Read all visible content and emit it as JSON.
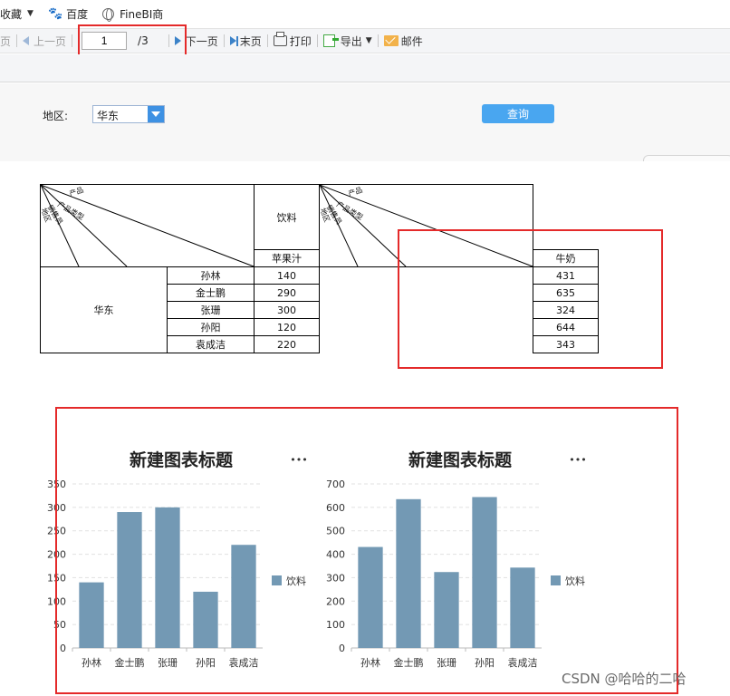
{
  "bookmarks": [
    {
      "label": "收藏",
      "icon": "caret-icon"
    },
    {
      "label": "百度",
      "icon": "baidu-paw-icon"
    },
    {
      "label": "FineBI商",
      "icon": "globe-icon"
    }
  ],
  "toolbar": {
    "first_page": "页",
    "prev_page": "上一页",
    "page_value": "1",
    "page_total": "/3",
    "next_page": "下一页",
    "last_page": "末页",
    "print": "打印",
    "export": "导出",
    "mail": "邮件"
  },
  "param": {
    "region_label": "地区:",
    "region_value": "华东",
    "query_label": "查询"
  },
  "report": {
    "diag_labels": [
      "产品",
      "产品类型",
      "销售员",
      "地区"
    ],
    "left_header": "饮料",
    "left_product": "苹果汁",
    "right_product": "牛奶",
    "region": "华东",
    "rows": [
      {
        "name": "孙林",
        "left": "140",
        "right": "431"
      },
      {
        "name": "金士鹏",
        "left": "290",
        "right": "635"
      },
      {
        "name": "张珊",
        "left": "300",
        "right": "324"
      },
      {
        "name": "孙阳",
        "left": "120",
        "right": "644"
      },
      {
        "name": "袁成洁",
        "left": "220",
        "right": "343"
      }
    ]
  },
  "colors": {
    "bar": "#7399b4",
    "highlight": "#e42a2a",
    "query_button": "#49a6f0"
  },
  "chart_data": [
    {
      "type": "bar",
      "title": "新建图表标题",
      "categories": [
        "孙林",
        "金士鹏",
        "张珊",
        "孙阳",
        "袁成洁"
      ],
      "series": [
        {
          "name": "饮料",
          "values": [
            140,
            290,
            300,
            120,
            220
          ]
        }
      ],
      "ylim": [
        0,
        350
      ],
      "yticks": [
        0,
        50,
        100,
        150,
        200,
        250,
        300,
        350
      ],
      "grid": true,
      "legend": "right",
      "menu_label": "•••"
    },
    {
      "type": "bar",
      "title": "新建图表标题",
      "categories": [
        "孙林",
        "金士鹏",
        "张珊",
        "孙阳",
        "袁成洁"
      ],
      "series": [
        {
          "name": "饮料",
          "values": [
            431,
            635,
            324,
            644,
            343
          ]
        }
      ],
      "ylim": [
        0,
        700
      ],
      "yticks": [
        0,
        100,
        200,
        300,
        400,
        500,
        600,
        700
      ],
      "grid": true,
      "legend": "right",
      "menu_label": "•••"
    }
  ],
  "watermark": "CSDN @哈哈的二哈"
}
